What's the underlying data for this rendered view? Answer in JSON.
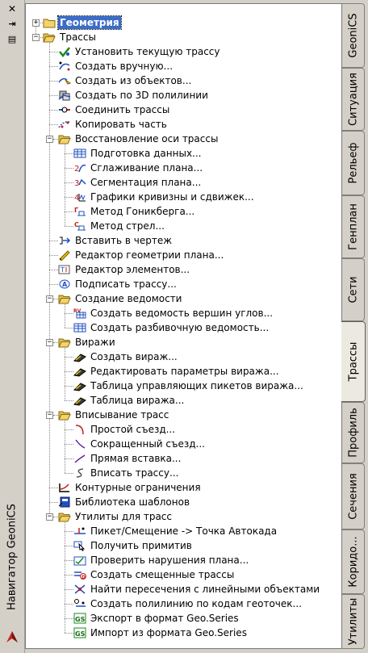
{
  "palette": {
    "title": "Навигатор GeoniCS",
    "close_glyph": "✕",
    "pin_glyph": "⇥",
    "menu_glyph": "▤"
  },
  "tree": [
    {
      "label": "Геометрия",
      "icon": "folder-closed-icon",
      "toggle": "+",
      "selected": true
    },
    {
      "label": "Трассы",
      "icon": "folder-open-icon",
      "toggle": "−"
    },
    {
      "label": "Установить текущую трассу",
      "icon": "set-current-route-icon"
    },
    {
      "label": "Создать вручную...",
      "icon": "create-manual-icon"
    },
    {
      "label": "Создать из объектов...",
      "icon": "create-from-objects-icon"
    },
    {
      "label": "Создать по 3D полилинии",
      "icon": "polyline-3d-icon"
    },
    {
      "label": "Соединить трассы",
      "icon": "join-routes-icon"
    },
    {
      "label": "Копировать часть",
      "icon": "copy-part-icon"
    },
    {
      "label": "Восстановление оси трассы",
      "icon": "folder-open-icon",
      "toggle": "−"
    },
    {
      "label": "Подготовка данных...",
      "icon": "data-table-icon"
    },
    {
      "label": "Сглаживание плана...",
      "icon": "smoothing-icon"
    },
    {
      "label": "Сегментация плана...",
      "icon": "segmentation-icon"
    },
    {
      "label": "Графики кривизны и сдвижек...",
      "icon": "curvature-chart-icon"
    },
    {
      "label": "Метод Гоникберга...",
      "icon": "gonikberg-method-icon"
    },
    {
      "label": "Метод стрел...",
      "icon": "arrows-method-icon"
    },
    {
      "label": "Вставить в чертеж",
      "icon": "insert-drawing-icon"
    },
    {
      "label": "Редактор геометрии плана...",
      "icon": "geometry-editor-icon"
    },
    {
      "label": "Редактор элементов...",
      "icon": "elements-editor-icon"
    },
    {
      "label": "Подписать трассу...",
      "icon": "label-route-icon"
    },
    {
      "label": "Создание ведомости",
      "icon": "folder-open-icon",
      "toggle": "−"
    },
    {
      "label": "Создать ведомость вершин углов...",
      "icon": "vertex-statement-icon"
    },
    {
      "label": "Создать разбивочную ведомость...",
      "icon": "layout-statement-icon"
    },
    {
      "label": "Виражи",
      "icon": "folder-open-icon",
      "toggle": "−"
    },
    {
      "label": "Создать вираж...",
      "icon": "create-superelevation-icon"
    },
    {
      "label": "Редактировать параметры виража...",
      "icon": "edit-superelevation-icon"
    },
    {
      "label": "Таблица управляющих пикетов виража...",
      "icon": "control-pickets-table-icon"
    },
    {
      "label": "Таблица виража...",
      "icon": "superelevation-table-icon"
    },
    {
      "label": "Вписывание трасс",
      "icon": "folder-open-icon",
      "toggle": "−"
    },
    {
      "label": "Простой съезд...",
      "icon": "simple-exit-icon"
    },
    {
      "label": "Сокращенный съезд...",
      "icon": "short-exit-icon"
    },
    {
      "label": "Прямая вставка...",
      "icon": "straight-insert-icon"
    },
    {
      "label": "Вписать трассу...",
      "icon": "fit-route-icon"
    },
    {
      "label": "Контурные ограничения",
      "icon": "contour-limits-icon"
    },
    {
      "label": "Библиотека шаблонов",
      "icon": "template-library-icon"
    },
    {
      "label": "Утилиты для трасс",
      "icon": "folder-open-icon",
      "toggle": "−"
    },
    {
      "label": "Пикет/Смещение -> Точка Автокада",
      "icon": "picket-offset-icon"
    },
    {
      "label": "Получить примитив",
      "icon": "get-primitive-icon"
    },
    {
      "label": "Проверить нарушения плана...",
      "icon": "check-violations-icon"
    },
    {
      "label": "Создать смещенные трассы",
      "icon": "offset-routes-icon"
    },
    {
      "label": "Найти пересечения с линейными объектами",
      "icon": "find-intersections-icon"
    },
    {
      "label": "Создать полилинию по кодам геоточек...",
      "icon": "polyline-geopoints-icon"
    },
    {
      "label": "Экспорт в формат Geo.Series",
      "icon": "export-geoseries-icon"
    },
    {
      "label": "Импорт из формата Geo.Series",
      "icon": "import-geoseries-icon"
    }
  ],
  "tabs": [
    {
      "label": "GeoniCS"
    },
    {
      "label": "Ситуация"
    },
    {
      "label": "Рельеф"
    },
    {
      "label": "Генплан"
    },
    {
      "label": "Сети"
    },
    {
      "label": "Трассы",
      "active": true
    },
    {
      "label": "Профиль"
    },
    {
      "label": "Сечения"
    },
    {
      "label": "Коридо..."
    },
    {
      "label": "Утилиты"
    }
  ],
  "colors": {
    "selection": "#3b6cc8",
    "folder": "#f3d36b",
    "panel_bg": "#d4d0c8"
  }
}
